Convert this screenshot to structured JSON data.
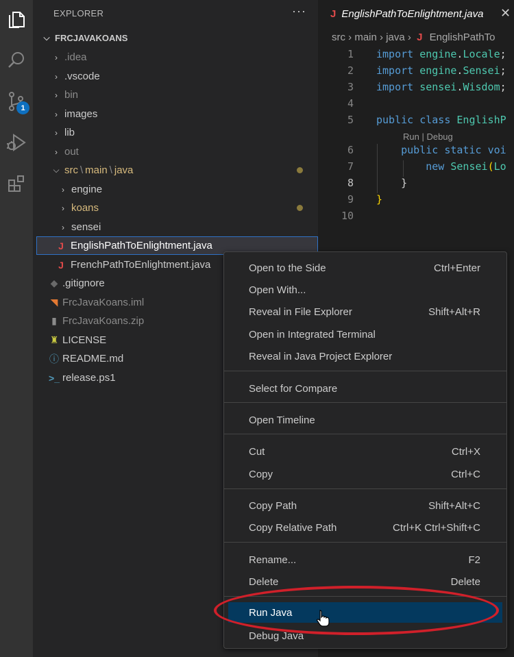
{
  "activity_bar": {
    "icons": [
      "files-icon",
      "search-icon",
      "source-control-icon",
      "run-debug-icon",
      "extensions-icon"
    ],
    "scm_badge": "1"
  },
  "explorer": {
    "header": "EXPLORER",
    "more": "···",
    "root": "FRCJAVAKOANS",
    "items": [
      {
        "label": ".idea",
        "type": "folder"
      },
      {
        "label": ".vscode",
        "type": "folder"
      },
      {
        "label": "bin",
        "type": "folder"
      },
      {
        "label": "images",
        "type": "folder"
      },
      {
        "label": "lib",
        "type": "folder"
      },
      {
        "label": "out",
        "type": "folder"
      },
      {
        "label_parts": [
          "src",
          "main",
          "java"
        ],
        "type": "folder-open"
      },
      {
        "label": "engine",
        "type": "folder"
      },
      {
        "label": "koans",
        "type": "folder"
      },
      {
        "label": "sensei",
        "type": "folder"
      },
      {
        "label": "EnglishPathToEnlightment.java",
        "type": "java"
      },
      {
        "label": "FrenchPathToEnlightment.java",
        "type": "java"
      },
      {
        "label": ".gitignore",
        "type": "git"
      },
      {
        "label": "FrcJavaKoans.iml",
        "type": "iml"
      },
      {
        "label": "FrcJavaKoans.zip",
        "type": "zip"
      },
      {
        "label": "LICENSE",
        "type": "license"
      },
      {
        "label": "README.md",
        "type": "info"
      },
      {
        "label": "release.ps1",
        "type": "powershell"
      }
    ]
  },
  "editor": {
    "tab_title": "EnglishPathToEnlightment.java",
    "tab_close": "✕",
    "breadcrumb": [
      "src",
      "main",
      "java",
      "EnglishPathTo"
    ],
    "lens": "Run | Debug",
    "line_numbers": [
      "1",
      "2",
      "3",
      "4",
      "5",
      "6",
      "7",
      "8",
      "9",
      "10"
    ]
  },
  "context_menu": {
    "groups": [
      [
        {
          "label": "Open to the Side",
          "key": "Ctrl+Enter"
        },
        {
          "label": "Open With...",
          "key": ""
        },
        {
          "label": "Reveal in File Explorer",
          "key": "Shift+Alt+R"
        },
        {
          "label": "Open in Integrated Terminal",
          "key": ""
        },
        {
          "label": "Reveal in Java Project Explorer",
          "key": ""
        }
      ],
      [
        {
          "label": "Select for Compare",
          "key": ""
        }
      ],
      [
        {
          "label": "Open Timeline",
          "key": ""
        }
      ],
      [
        {
          "label": "Cut",
          "key": "Ctrl+X"
        },
        {
          "label": "Copy",
          "key": "Ctrl+C"
        }
      ],
      [
        {
          "label": "Copy Path",
          "key": "Shift+Alt+C"
        },
        {
          "label": "Copy Relative Path",
          "key": "Ctrl+K Ctrl+Shift+C"
        }
      ],
      [
        {
          "label": "Rename...",
          "key": "F2"
        },
        {
          "label": "Delete",
          "key": "Delete"
        }
      ],
      [
        {
          "label": "Run Java",
          "key": ""
        },
        {
          "label": "Debug Java",
          "key": ""
        }
      ]
    ]
  }
}
